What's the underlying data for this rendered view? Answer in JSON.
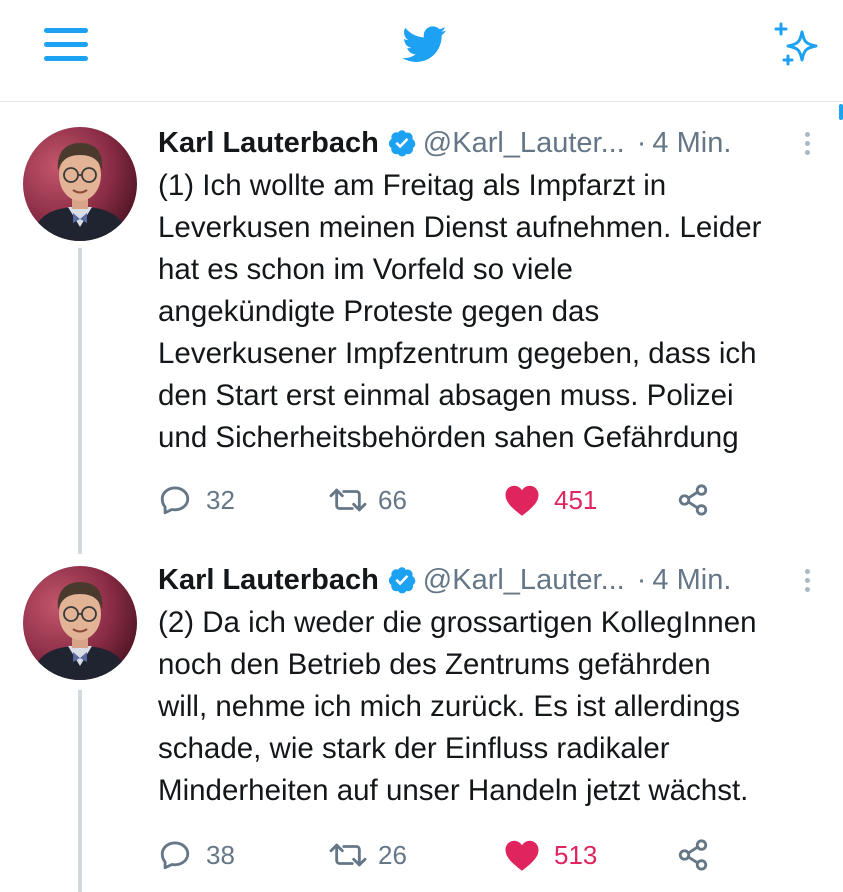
{
  "header": {
    "menu_icon": "hamburger-menu-icon",
    "logo_icon": "twitter-bird-icon",
    "sparkle_icon": "top-tweets-sparkle-icon",
    "accent_color": "#1da1f2"
  },
  "tweets": [
    {
      "author_name": "Karl Lauterbach",
      "verified": true,
      "handle": "@Karl_Lauter...",
      "separator": "·",
      "time": "4 Min.",
      "text_lines": [
        "(1) Ich wollte am Freitag als Impfarzt in",
        "Leverkusen meinen Dienst aufnehmen. Leider",
        "hat es schon im Vorfeld so viele",
        "angekündigte Proteste gegen das",
        "Leverkusener Impfzentrum gegeben, dass ich",
        "den Start erst einmal absagen muss. Polizei",
        "und Sicherheitsbehörden sahen Gefährdung"
      ],
      "replies": "32",
      "retweets": "66",
      "likes": "451",
      "liked": true
    },
    {
      "author_name": "Karl Lauterbach",
      "verified": true,
      "handle": "@Karl_Lauter...",
      "separator": "·",
      "time": "4 Min.",
      "text_lines": [
        "(2) Da ich weder die grossartigen KollegInnen",
        "noch den Betrieb des Zentrums gefährden",
        "will, nehme ich mich zurück. Es ist allerdings",
        "schade, wie stark der Einfluss radikaler",
        "Minderheiten auf unser Handeln jetzt wächst."
      ],
      "replies": "38",
      "retweets": "26",
      "likes": "513",
      "liked": true
    }
  ],
  "colors": {
    "like_active": "#e0245e",
    "secondary_text": "#657786",
    "primary_text": "#14171a",
    "verified_badge": "#1da1f2",
    "thread_line": "#cfd9de"
  }
}
